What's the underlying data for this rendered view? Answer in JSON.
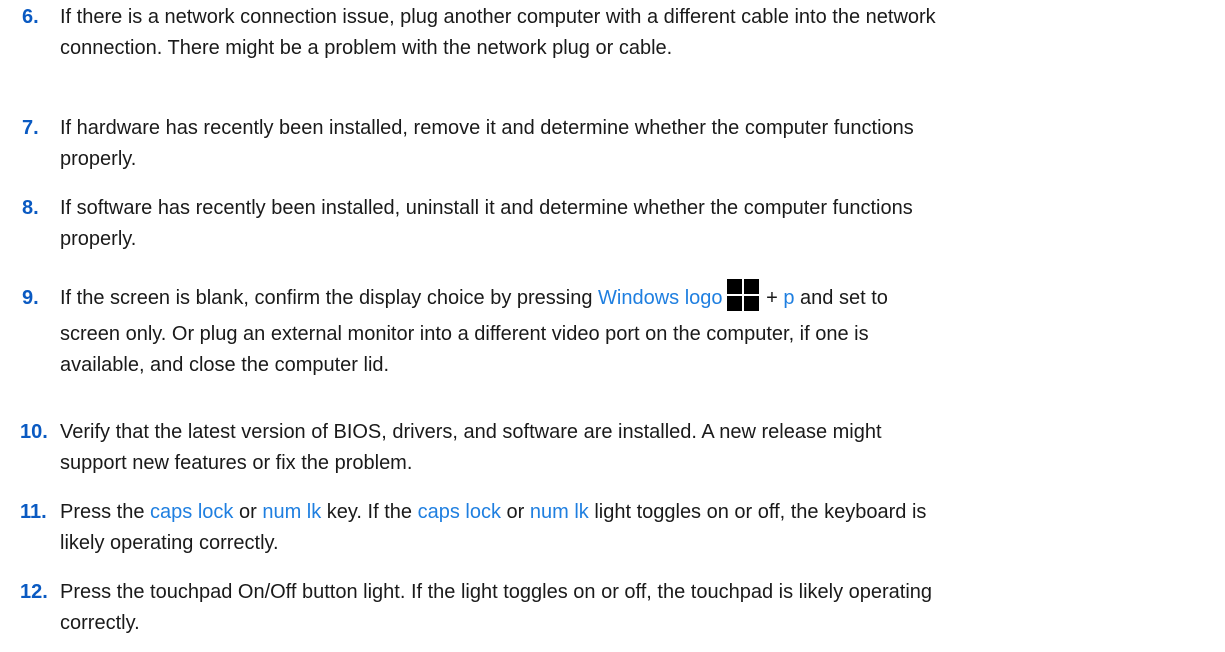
{
  "steps": [
    {
      "num": "6.",
      "line1": "If there is a network connection issue, plug another computer with a different cable into the network",
      "line2": "connection. There might be a problem with the network plug or cable."
    },
    {
      "num": "7.",
      "line1": "If hardware has recently been installed, remove it and determine whether the computer functions",
      "line2": "properly."
    },
    {
      "num": "8.",
      "line1": "If software has recently been installed, uninstall it and determine whether the computer functions",
      "line2": "properly."
    },
    {
      "num": "9.",
      "line1_a": "If the screen is blank, confirm the display choice by pressing ",
      "line1_key": "Windows logo",
      "line1_plus": " + ",
      "line1_key2": "p",
      "line1_b": " and set to",
      "line2": "screen only. Or plug an external monitor into a different video port on the computer, if one is",
      "line3": "available, and close the computer lid."
    },
    {
      "num": "10.",
      "line1": "Verify that the latest version of BIOS, drivers, and software are installed. A new release might",
      "line2": "support new features or fix the problem."
    },
    {
      "num": "11.",
      "line1_a": "Press the ",
      "key_caps": "caps lock",
      "or1": " or ",
      "key_num": "num lk",
      "line1_b": " key. If the ",
      "key_caps2": "caps lock",
      "or2": " or ",
      "key_num2": "num lk",
      "line1_c": " light toggles on or off, the keyboard is",
      "line2": "likely operating correctly."
    },
    {
      "num": "12.",
      "line1": "Press the touchpad On/Off button light. If the light toggles on or off, the touchpad is likely operating",
      "line2": "correctly."
    }
  ],
  "colors": {
    "number": "#0a5ac2",
    "link": "#1f7fe0",
    "text": "#1a1a1a"
  },
  "icons": {
    "windows_key": "windows-logo-icon"
  }
}
